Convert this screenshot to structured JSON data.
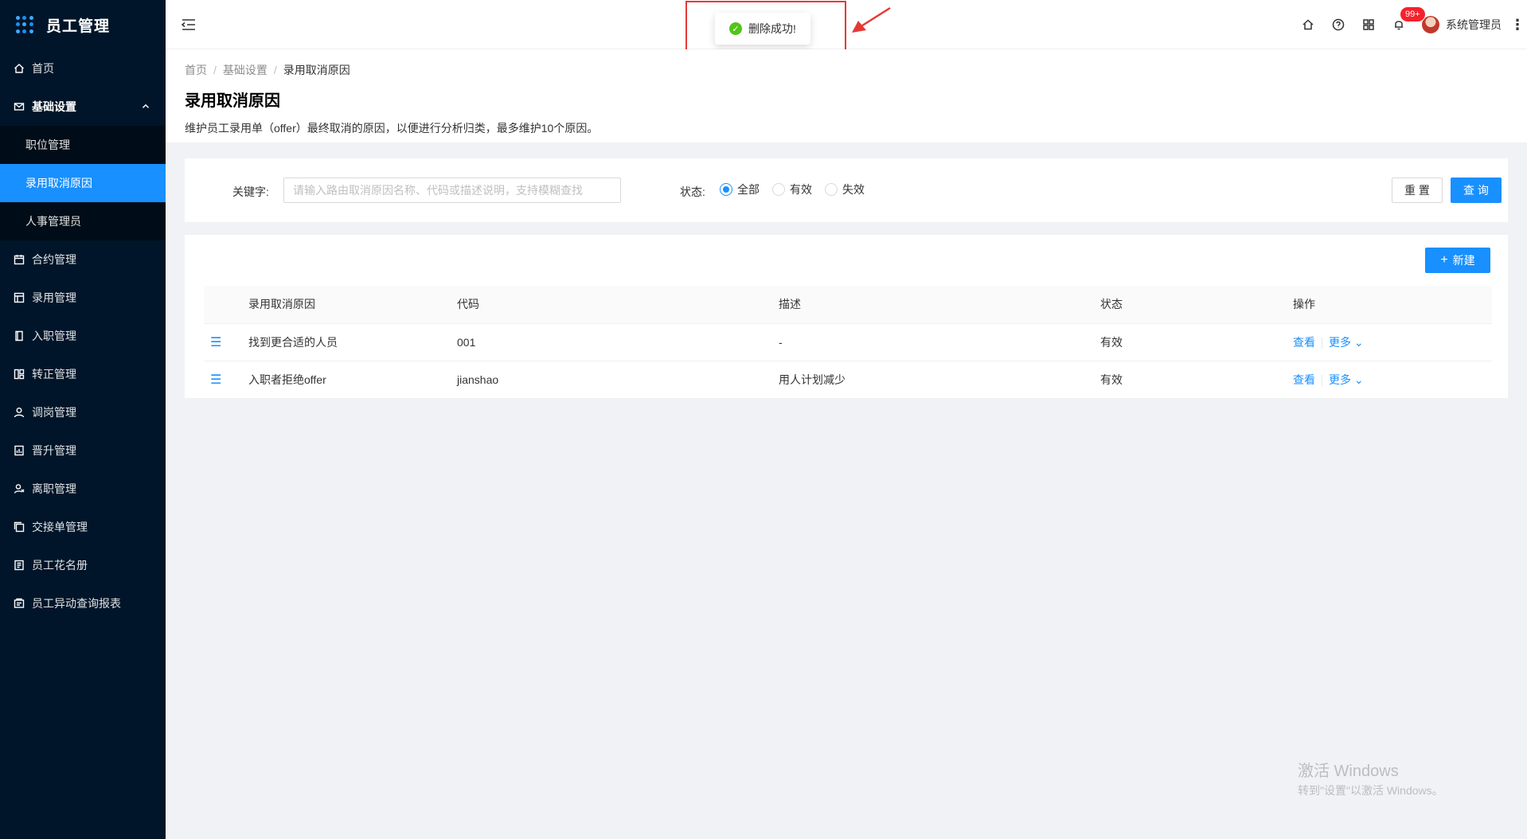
{
  "app": {
    "title": "员工管理"
  },
  "sidebar": {
    "items": [
      {
        "label": "首页",
        "icon": "home-icon"
      },
      {
        "label": "基础设置",
        "icon": "mail-icon",
        "open": true,
        "children": [
          {
            "label": "职位管理"
          },
          {
            "label": "录用取消原因",
            "active": true
          },
          {
            "label": "人事管理员"
          }
        ]
      },
      {
        "label": "合约管理",
        "icon": "calendar-icon"
      },
      {
        "label": "录用管理",
        "icon": "table-icon"
      },
      {
        "label": "入职管理",
        "icon": "book-icon"
      },
      {
        "label": "转正管理",
        "icon": "layout-icon"
      },
      {
        "label": "调岗管理",
        "icon": "user-icon"
      },
      {
        "label": "晋升管理",
        "icon": "file-chart-icon"
      },
      {
        "label": "离职管理",
        "icon": "user-leave-icon"
      },
      {
        "label": "交接单管理",
        "icon": "copy-icon"
      },
      {
        "label": "员工花名册",
        "icon": "roster-icon"
      },
      {
        "label": "员工异动查询报表",
        "icon": "report-icon"
      }
    ]
  },
  "header": {
    "badge": "99+",
    "user_name": "系统管理员"
  },
  "toast": {
    "message": "删除成功!"
  },
  "breadcrumb": [
    "首页",
    "基础设置",
    "录用取消原因"
  ],
  "page": {
    "title": "录用取消原因",
    "description": "维护员工录用单（offer）最终取消的原因，以便进行分析归类，最多维护10个原因。"
  },
  "search": {
    "keyword_label": "关键字:",
    "keyword_placeholder": "请输入路由取消原因名称、代码或描述说明，支持模糊查找",
    "status_label": "状态:",
    "status_options": [
      "全部",
      "有效",
      "失效"
    ],
    "status_selected": "全部",
    "reset_label": "重 置",
    "query_label": "查 询"
  },
  "table": {
    "new_label": "新建",
    "columns": [
      "录用取消原因",
      "代码",
      "描述",
      "状态",
      "操作"
    ],
    "rows": [
      {
        "reason": "找到更合适的人员",
        "code": "001",
        "desc": "-",
        "status": "有效",
        "view": "查看",
        "more": "更多"
      },
      {
        "reason": "入职者拒绝offer",
        "code": "jianshao",
        "desc": "用人计划减少",
        "status": "有效",
        "view": "查看",
        "more": "更多"
      }
    ]
  },
  "watermark": {
    "line1": "激活 Windows",
    "line2": "转到\"设置\"以激活 Windows。"
  },
  "colors": {
    "primary": "#1890ff",
    "sidebar_bg": "#001529",
    "success": "#52c41a",
    "highlight_box": "#e53935"
  }
}
